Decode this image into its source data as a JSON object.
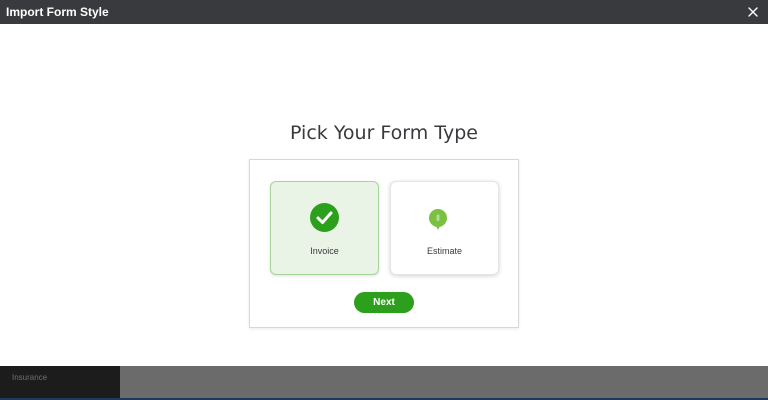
{
  "dialog": {
    "title": "Import Form Style",
    "close_icon": "close-icon",
    "heading": "Pick Your Form Type",
    "options": [
      {
        "label": "Invoice",
        "icon": "checkmark-circle-icon",
        "selected": true
      },
      {
        "label": "Estimate",
        "icon": "lightbulb-icon",
        "selected": false
      }
    ],
    "next_label": "Next"
  },
  "background": {
    "item_label": "Insurance"
  },
  "colors": {
    "titlebar": "#393a3d",
    "accent": "#2ca01c",
    "selected_card": "#e9f4e6",
    "overlay": "#6b6b6b"
  }
}
